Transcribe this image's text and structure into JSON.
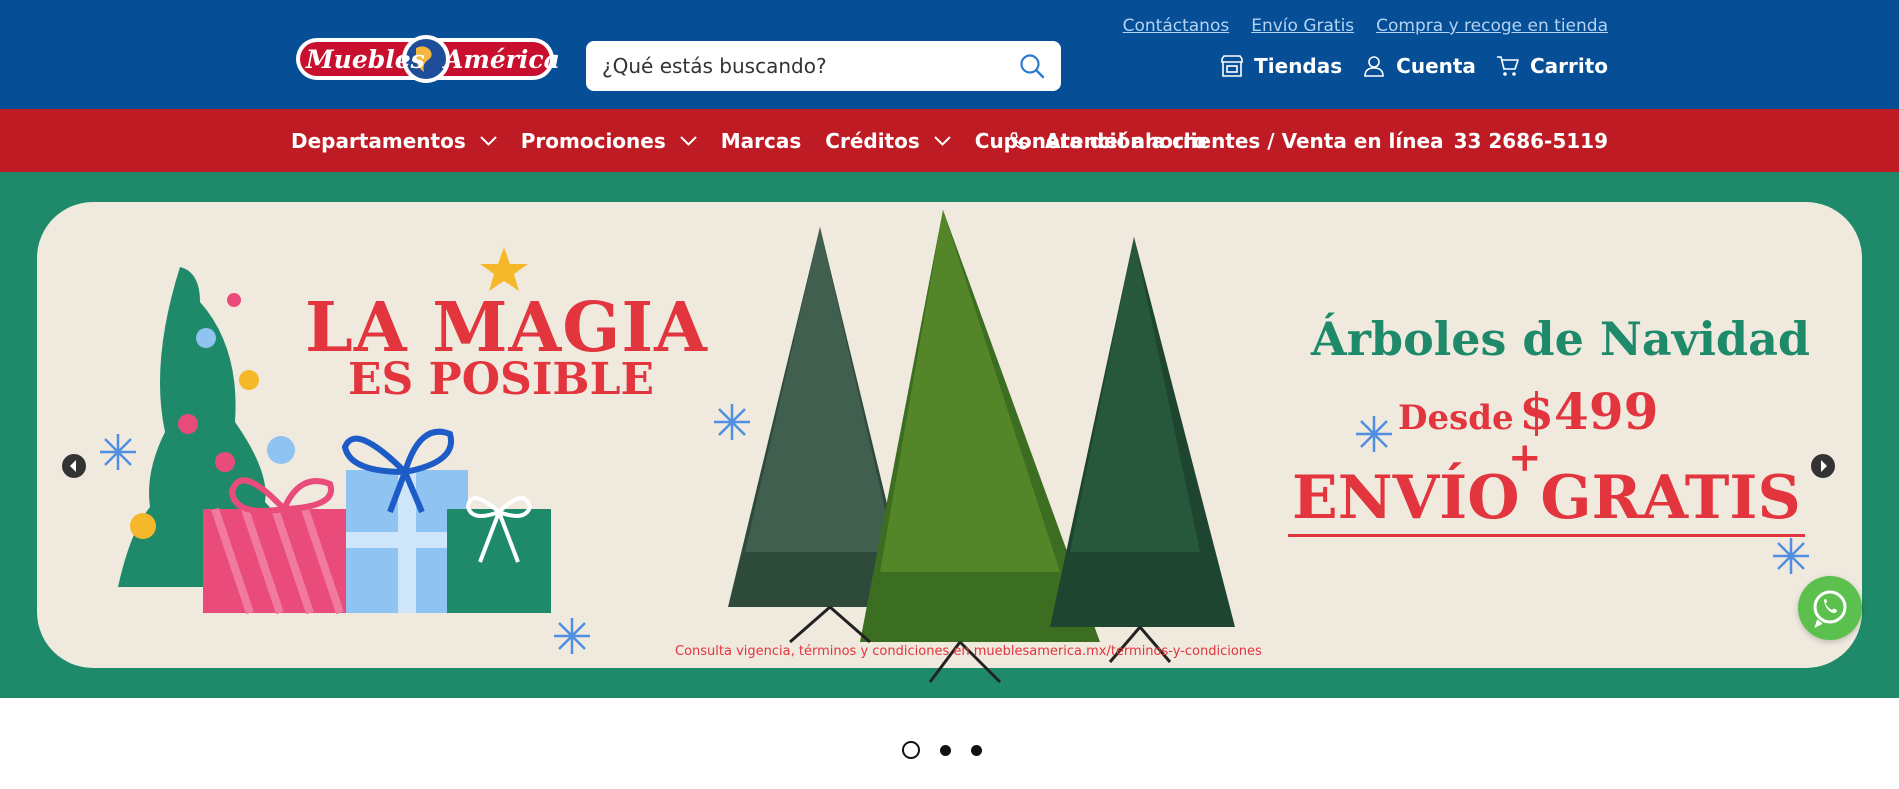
{
  "brand": {
    "logo_text_1": "Muebles",
    "logo_text_2": "América",
    "colors": {
      "header_blue": "#064f96",
      "nav_red": "#bf1b24",
      "banner_green": "#1f8a6a",
      "accent_red": "#e2353e",
      "whatsapp_green": "#5bc04d"
    }
  },
  "search": {
    "placeholder": "¿Qué estás buscando?",
    "icon": "search-icon"
  },
  "top_links": [
    "Contáctanos",
    "Envío Gratis",
    "Compra y recoge en tienda"
  ],
  "account_bar": {
    "stores": {
      "label": "Tiendas",
      "icon": "store-icon"
    },
    "account": {
      "label": "Cuenta",
      "icon": "user-icon"
    },
    "cart": {
      "label": "Carrito",
      "icon": "cart-icon"
    }
  },
  "nav": {
    "items": [
      {
        "label": "Departamentos",
        "dropdown": true
      },
      {
        "label": "Promociones",
        "dropdown": true
      },
      {
        "label": "Marcas",
        "dropdown": false
      },
      {
        "label": "Créditos",
        "dropdown": true
      },
      {
        "label": "Cuponera del ahorro",
        "dropdown": false
      }
    ],
    "support_label": "Atención a clientes / Venta en línea",
    "support_phone": "33 2686-5119",
    "support_icon": "phone-icon"
  },
  "banner": {
    "headline_1": "LA MAGIA",
    "headline_2": "ES POSIBLE",
    "product": "Árboles de Navidad",
    "desde": "Desde",
    "price": "$499",
    "plus": "+",
    "shipping": "ENVÍO GRATIS",
    "legal": "Consulta vigencia, términos y condiciones en mueblesamerica.mx/terminos-y-condiciones"
  },
  "carousel": {
    "slides": 3,
    "active_slide": 1
  },
  "whatsapp": {
    "icon": "whatsapp-icon"
  }
}
